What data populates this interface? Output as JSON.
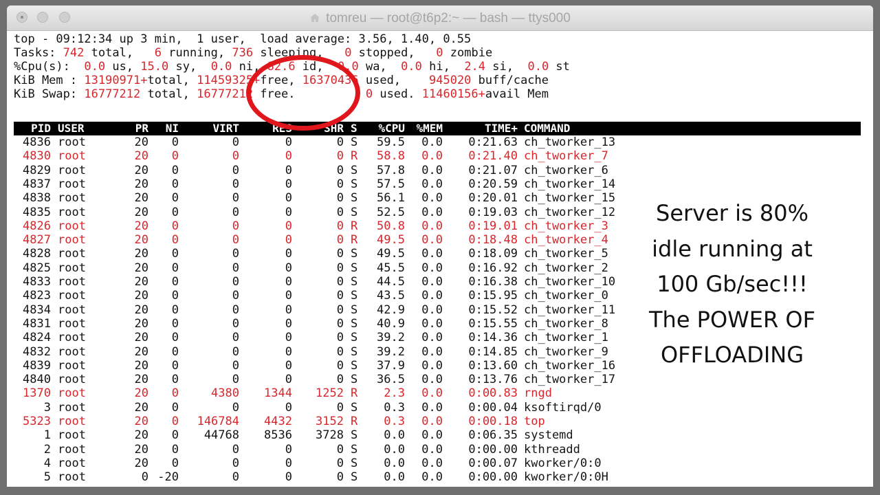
{
  "window": {
    "title": "tomreu — root@t6p2:~ — bash — ttys000"
  },
  "summary": {
    "line1": "top - 09:12:34 up 3 min,  1 user,  load average: 3.56, 1.40, 0.55",
    "tasks": {
      "label": "Tasks:",
      "total": "742",
      "total_label": " total,",
      "running": "6",
      "running_label": " running,",
      "sleeping": "736",
      "sleeping_label": " sleeping,",
      "stopped": "0",
      "stopped_label": " stopped,",
      "zombie": "0",
      "zombie_label": " zombie"
    },
    "cpu": {
      "label": "%Cpu(s):",
      "us": "0.0",
      "us_label": " us,",
      "sy": "15.0",
      "sy_label": " sy,",
      "ni": "0.0",
      "ni_label": " ni,",
      "id": "82.6",
      "id_label": " id,",
      "wa": "0.0",
      "wa_label": " wa,",
      "hi": "0.0",
      "hi_label": " hi,",
      "si": "2.4",
      "si_label": " si,",
      "st": "0.0",
      "st_label": " st"
    },
    "mem": {
      "label": "KiB Mem :",
      "total": "13190971+",
      "total_label": "total,",
      "free": "11459325+",
      "free_label": "free,",
      "used": "16370436",
      "used_label": " used,",
      "cache": "945020",
      "cache_label": " buff/cache"
    },
    "swap": {
      "label": "KiB Swap:",
      "total": "16777212",
      "total_label": " total,",
      "free": "16777212",
      "free_label": " free.",
      "used": "0",
      "used_label": " used.",
      "avail": "11460156+",
      "avail_label": "avail Mem"
    }
  },
  "table": {
    "headers": {
      "pid": "PID",
      "user": "USER",
      "pr": "PR",
      "ni": "NI",
      "virt": "VIRT",
      "res": "RES",
      "shr": "SHR",
      "s": "S",
      "cpu": "%CPU",
      "mem": "%MEM",
      "time": "TIME+",
      "command": "COMMAND"
    },
    "rows": [
      {
        "pid": "4836",
        "user": "root",
        "pr": "20",
        "ni": "0",
        "virt": "0",
        "res": "0",
        "shr": "0",
        "s": "S",
        "cpu": "59.5",
        "mem": "0.0",
        "time": "0:21.63",
        "command": "ch_tworker_13",
        "hot": false
      },
      {
        "pid": "4830",
        "user": "root",
        "pr": "20",
        "ni": "0",
        "virt": "0",
        "res": "0",
        "shr": "0",
        "s": "R",
        "cpu": "58.8",
        "mem": "0.0",
        "time": "0:21.40",
        "command": "ch_tworker_7",
        "hot": true
      },
      {
        "pid": "4829",
        "user": "root",
        "pr": "20",
        "ni": "0",
        "virt": "0",
        "res": "0",
        "shr": "0",
        "s": "S",
        "cpu": "57.8",
        "mem": "0.0",
        "time": "0:21.07",
        "command": "ch_tworker_6",
        "hot": false
      },
      {
        "pid": "4837",
        "user": "root",
        "pr": "20",
        "ni": "0",
        "virt": "0",
        "res": "0",
        "shr": "0",
        "s": "S",
        "cpu": "57.5",
        "mem": "0.0",
        "time": "0:20.59",
        "command": "ch_tworker_14",
        "hot": false
      },
      {
        "pid": "4838",
        "user": "root",
        "pr": "20",
        "ni": "0",
        "virt": "0",
        "res": "0",
        "shr": "0",
        "s": "S",
        "cpu": "56.1",
        "mem": "0.0",
        "time": "0:20.01",
        "command": "ch_tworker_15",
        "hot": false
      },
      {
        "pid": "4835",
        "user": "root",
        "pr": "20",
        "ni": "0",
        "virt": "0",
        "res": "0",
        "shr": "0",
        "s": "S",
        "cpu": "52.5",
        "mem": "0.0",
        "time": "0:19.03",
        "command": "ch_tworker_12",
        "hot": false
      },
      {
        "pid": "4826",
        "user": "root",
        "pr": "20",
        "ni": "0",
        "virt": "0",
        "res": "0",
        "shr": "0",
        "s": "R",
        "cpu": "50.8",
        "mem": "0.0",
        "time": "0:19.01",
        "command": "ch_tworker_3",
        "hot": true
      },
      {
        "pid": "4827",
        "user": "root",
        "pr": "20",
        "ni": "0",
        "virt": "0",
        "res": "0",
        "shr": "0",
        "s": "R",
        "cpu": "49.5",
        "mem": "0.0",
        "time": "0:18.48",
        "command": "ch_tworker_4",
        "hot": true
      },
      {
        "pid": "4828",
        "user": "root",
        "pr": "20",
        "ni": "0",
        "virt": "0",
        "res": "0",
        "shr": "0",
        "s": "S",
        "cpu": "49.5",
        "mem": "0.0",
        "time": "0:18.09",
        "command": "ch_tworker_5",
        "hot": false
      },
      {
        "pid": "4825",
        "user": "root",
        "pr": "20",
        "ni": "0",
        "virt": "0",
        "res": "0",
        "shr": "0",
        "s": "S",
        "cpu": "45.5",
        "mem": "0.0",
        "time": "0:16.92",
        "command": "ch_tworker_2",
        "hot": false
      },
      {
        "pid": "4833",
        "user": "root",
        "pr": "20",
        "ni": "0",
        "virt": "0",
        "res": "0",
        "shr": "0",
        "s": "S",
        "cpu": "44.5",
        "mem": "0.0",
        "time": "0:16.38",
        "command": "ch_tworker_10",
        "hot": false
      },
      {
        "pid": "4823",
        "user": "root",
        "pr": "20",
        "ni": "0",
        "virt": "0",
        "res": "0",
        "shr": "0",
        "s": "S",
        "cpu": "43.5",
        "mem": "0.0",
        "time": "0:15.95",
        "command": "ch_tworker_0",
        "hot": false
      },
      {
        "pid": "4834",
        "user": "root",
        "pr": "20",
        "ni": "0",
        "virt": "0",
        "res": "0",
        "shr": "0",
        "s": "S",
        "cpu": "42.9",
        "mem": "0.0",
        "time": "0:15.52",
        "command": "ch_tworker_11",
        "hot": false
      },
      {
        "pid": "4831",
        "user": "root",
        "pr": "20",
        "ni": "0",
        "virt": "0",
        "res": "0",
        "shr": "0",
        "s": "S",
        "cpu": "40.9",
        "mem": "0.0",
        "time": "0:15.55",
        "command": "ch_tworker_8",
        "hot": false
      },
      {
        "pid": "4824",
        "user": "root",
        "pr": "20",
        "ni": "0",
        "virt": "0",
        "res": "0",
        "shr": "0",
        "s": "S",
        "cpu": "39.2",
        "mem": "0.0",
        "time": "0:14.36",
        "command": "ch_tworker_1",
        "hot": false
      },
      {
        "pid": "4832",
        "user": "root",
        "pr": "20",
        "ni": "0",
        "virt": "0",
        "res": "0",
        "shr": "0",
        "s": "S",
        "cpu": "39.2",
        "mem": "0.0",
        "time": "0:14.85",
        "command": "ch_tworker_9",
        "hot": false
      },
      {
        "pid": "4839",
        "user": "root",
        "pr": "20",
        "ni": "0",
        "virt": "0",
        "res": "0",
        "shr": "0",
        "s": "S",
        "cpu": "37.9",
        "mem": "0.0",
        "time": "0:13.60",
        "command": "ch_tworker_16",
        "hot": false
      },
      {
        "pid": "4840",
        "user": "root",
        "pr": "20",
        "ni": "0",
        "virt": "0",
        "res": "0",
        "shr": "0",
        "s": "S",
        "cpu": "36.5",
        "mem": "0.0",
        "time": "0:13.76",
        "command": "ch_tworker_17",
        "hot": false
      },
      {
        "pid": "1370",
        "user": "root",
        "pr": "20",
        "ni": "0",
        "virt": "4380",
        "res": "1344",
        "shr": "1252",
        "s": "R",
        "cpu": "2.3",
        "mem": "0.0",
        "time": "0:00.83",
        "command": "rngd",
        "hot": true
      },
      {
        "pid": "3",
        "user": "root",
        "pr": "20",
        "ni": "0",
        "virt": "0",
        "res": "0",
        "shr": "0",
        "s": "S",
        "cpu": "0.3",
        "mem": "0.0",
        "time": "0:00.04",
        "command": "ksoftirqd/0",
        "hot": false
      },
      {
        "pid": "5323",
        "user": "root",
        "pr": "20",
        "ni": "0",
        "virt": "146784",
        "res": "4432",
        "shr": "3152",
        "s": "R",
        "cpu": "0.3",
        "mem": "0.0",
        "time": "0:00.18",
        "command": "top",
        "hot": true
      },
      {
        "pid": "1",
        "user": "root",
        "pr": "20",
        "ni": "0",
        "virt": "44768",
        "res": "8536",
        "shr": "3728",
        "s": "S",
        "cpu": "0.0",
        "mem": "0.0",
        "time": "0:06.35",
        "command": "systemd",
        "hot": false
      },
      {
        "pid": "2",
        "user": "root",
        "pr": "20",
        "ni": "0",
        "virt": "0",
        "res": "0",
        "shr": "0",
        "s": "S",
        "cpu": "0.0",
        "mem": "0.0",
        "time": "0:00.00",
        "command": "kthreadd",
        "hot": false
      },
      {
        "pid": "4",
        "user": "root",
        "pr": "20",
        "ni": "0",
        "virt": "0",
        "res": "0",
        "shr": "0",
        "s": "S",
        "cpu": "0.0",
        "mem": "0.0",
        "time": "0:00.07",
        "command": "kworker/0:0",
        "hot": false
      },
      {
        "pid": "5",
        "user": "root",
        "pr": "0",
        "ni": "-20",
        "virt": "0",
        "res": "0",
        "shr": "0",
        "s": "S",
        "cpu": "0.0",
        "mem": "0.0",
        "time": "0:00.00",
        "command": "kworker/0:0H",
        "hot": false
      }
    ]
  },
  "annotation": {
    "lines": [
      "Server is 80%",
      "idle running at",
      "100 Gb/sec!!!",
      "The POWER OF",
      "OFFLOADING"
    ]
  },
  "colors": {
    "highlight": "#d9262c",
    "circle": "#e0161d",
    "header_bg": "#000000"
  }
}
